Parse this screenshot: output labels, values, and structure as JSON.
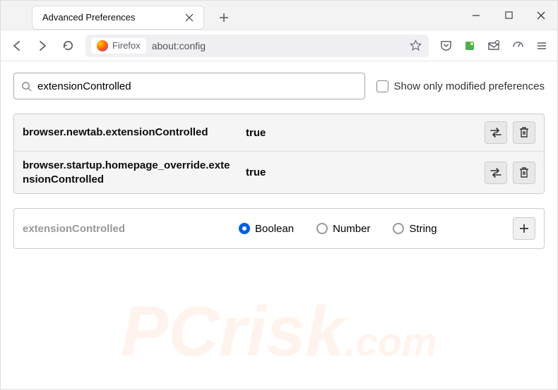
{
  "titlebar": {
    "tab_title": "Advanced Preferences"
  },
  "urlbar": {
    "identity_label": "Firefox",
    "value": "about:config"
  },
  "search": {
    "value": "extensionControlled",
    "show_modified_label": "Show only modified preferences"
  },
  "prefs": [
    {
      "name": "browser.newtab.extensionControlled",
      "value": "true"
    },
    {
      "name": "browser.startup.homepage_override.extensionControlled",
      "value": "true"
    }
  ],
  "add": {
    "name": "extensionControlled",
    "options": {
      "boolean": "Boolean",
      "number": "Number",
      "string": "String"
    }
  }
}
